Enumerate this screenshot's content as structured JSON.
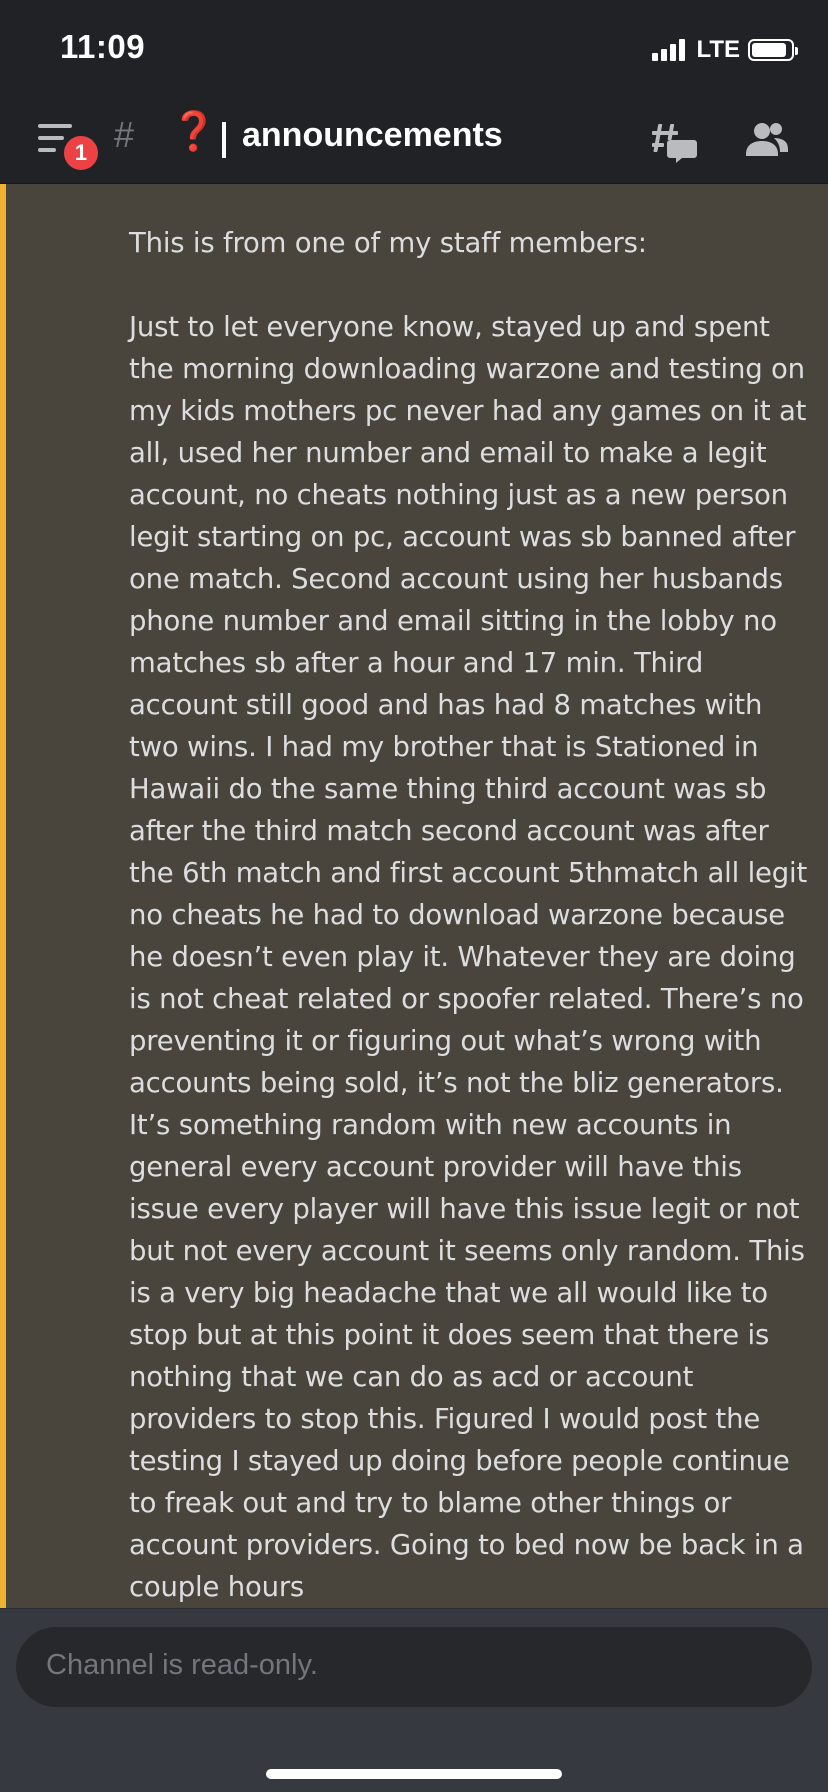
{
  "status_bar": {
    "time": "11:09",
    "network": "LTE",
    "signal_bars": 4,
    "battery_level": 0.9
  },
  "header": {
    "menu_icon": "hamburger-icon",
    "badge_count": "1",
    "hash_symbol": "#",
    "category_emoji": "❓",
    "channel_name": "announcements",
    "threads_icon": "threads-icon",
    "members_icon": "members-icon"
  },
  "colors": {
    "background": "#36393f",
    "header": "#202225",
    "message_highlight": "#49443c",
    "accent_bar": "#f0b232",
    "badge": "#ed4245",
    "text": "#dcddde"
  },
  "message": {
    "content": "This is from one of my staff members:\n\nJust to let everyone know, stayed up and spent the morning downloading warzone and testing on my kids mothers pc never had any games on it at all, used her number and email to make a legit account, no cheats nothing just as a new person legit starting on pc, account was sb banned after one match. Second account using her husbands phone number and email sitting in the lobby no matches sb after a hour and 17 min. Third account still good and has had 8 matches with two wins. I had my brother that is Stationed in Hawaii do the same thing third account was sb after the third match second account was after the 6th match and first account 5thmatch all legit no cheats he had to download warzone because he doesn’t even play it. Whatever they are doing is not cheat related or spoofer related. There’s no preventing it or figuring out what’s wrong with accounts being sold, it’s not the bliz generators. It’s something random with new accounts in general every account provider will have this issue every player will have this issue legit or not but not every account it seems only random. This is a very big headache that we all would like to stop but at this point it does seem that there is nothing that we can do as acd or account providers to stop this. Figured I would post the testing I stayed up doing before people continue to freak out and try to blame other things or account providers. Going to bed now be back in a couple hours"
  },
  "composer": {
    "placeholder": "Channel is read-only."
  }
}
